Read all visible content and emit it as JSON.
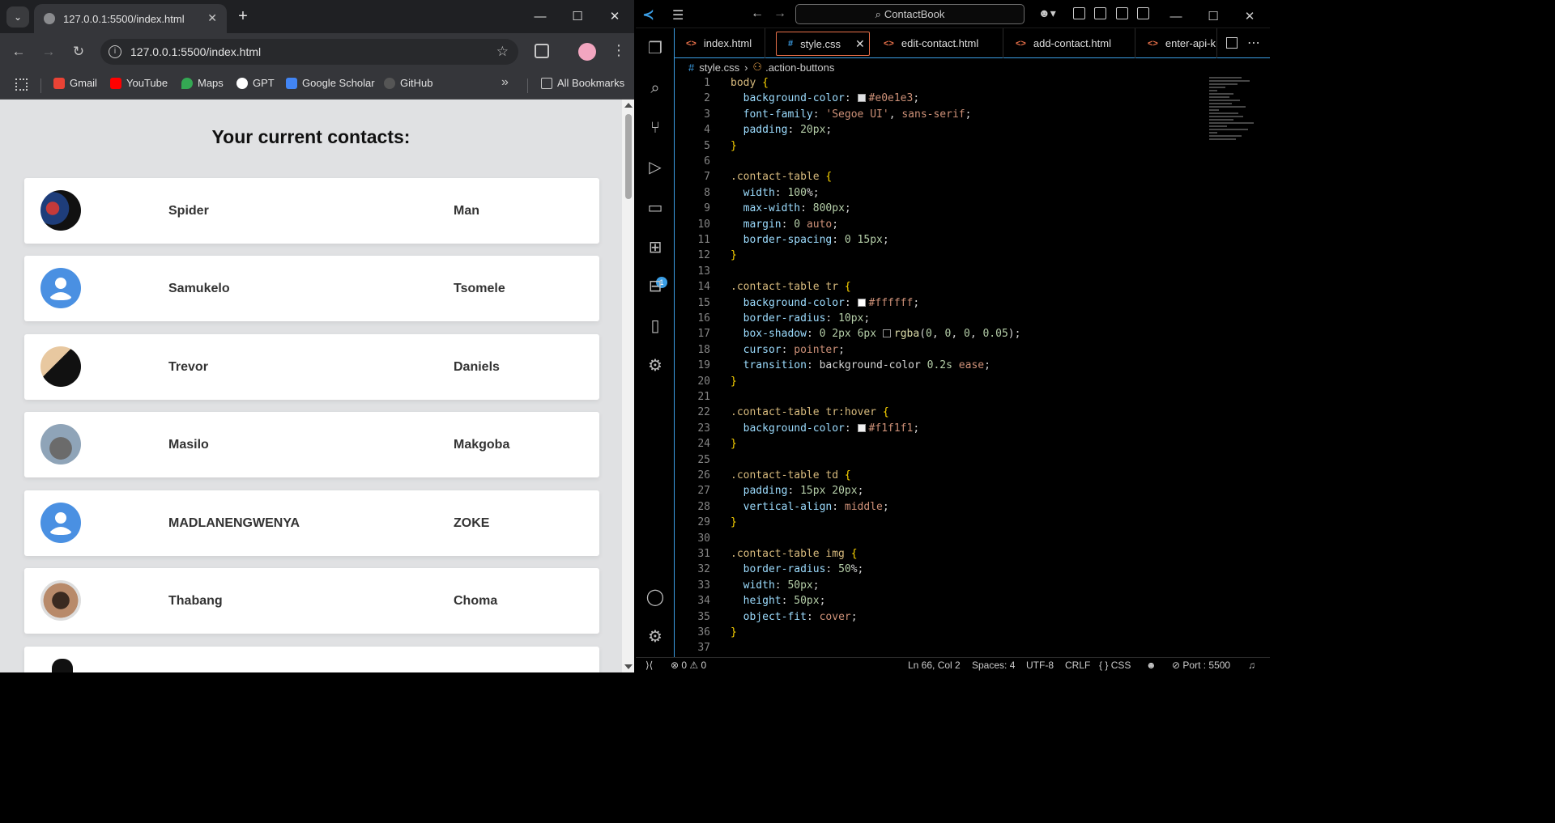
{
  "browser": {
    "tab_title": "127.0.0.1:5500/index.html",
    "url": "127.0.0.1:5500/index.html",
    "bookmarks": [
      "Gmail",
      "YouTube",
      "Maps",
      "GPT",
      "Google Scholar",
      "GitHub"
    ],
    "all_bookmarks": "All Bookmarks",
    "page": {
      "heading": "Your current contacts:",
      "contacts": [
        {
          "first": "Spider",
          "last": "Man"
        },
        {
          "first": "Samukelo",
          "last": "Tsomele"
        },
        {
          "first": "Trevor",
          "last": "Daniels"
        },
        {
          "first": "Masilo",
          "last": "Makgoba"
        },
        {
          "first": "MADLANENGWENYA",
          "last": "ZOKE"
        },
        {
          "first": "Thabang",
          "last": "Choma"
        }
      ]
    }
  },
  "vscode": {
    "search": "ContactBook",
    "tabs": [
      "index.html",
      "style.css",
      "edit-contact.html",
      "add-contact.html",
      "enter-api-k"
    ],
    "breadcrumb": {
      "file": "style.css",
      "symbol": ".action-buttons"
    },
    "status": {
      "errors": "0",
      "warnings": "0",
      "position": "Ln 66, Col 2",
      "spaces": "Spaces: 4",
      "encoding": "UTF-8",
      "eol": "CRLF",
      "language": "CSS",
      "port": "Port : 5500"
    },
    "code_lines": [
      "body {",
      "  background-color: #e0e1e3;",
      "  font-family: 'Segoe UI', sans-serif;",
      "  padding: 20px;",
      "}",
      "",
      ".contact-table {",
      "  width: 100%;",
      "  max-width: 800px;",
      "  margin: 0 auto;",
      "  border-spacing: 0 15px;",
      "}",
      "",
      ".contact-table tr {",
      "  background-color: #ffffff;",
      "  border-radius: 10px;",
      "  box-shadow: 0 2px 6px rgba(0, 0, 0, 0.05);",
      "  cursor: pointer;",
      "  transition: background-color 0.2s ease;",
      "}",
      "",
      ".contact-table tr:hover {",
      "  background-color: #f1f1f1;",
      "}",
      "",
      ".contact-table td {",
      "  padding: 15px 20px;",
      "  vertical-align: middle;",
      "}",
      "",
      ".contact-table img {",
      "  border-radius: 50%;",
      "  width: 50px;",
      "  height: 50px;",
      "  object-fit: cover;",
      "}",
      ""
    ]
  }
}
